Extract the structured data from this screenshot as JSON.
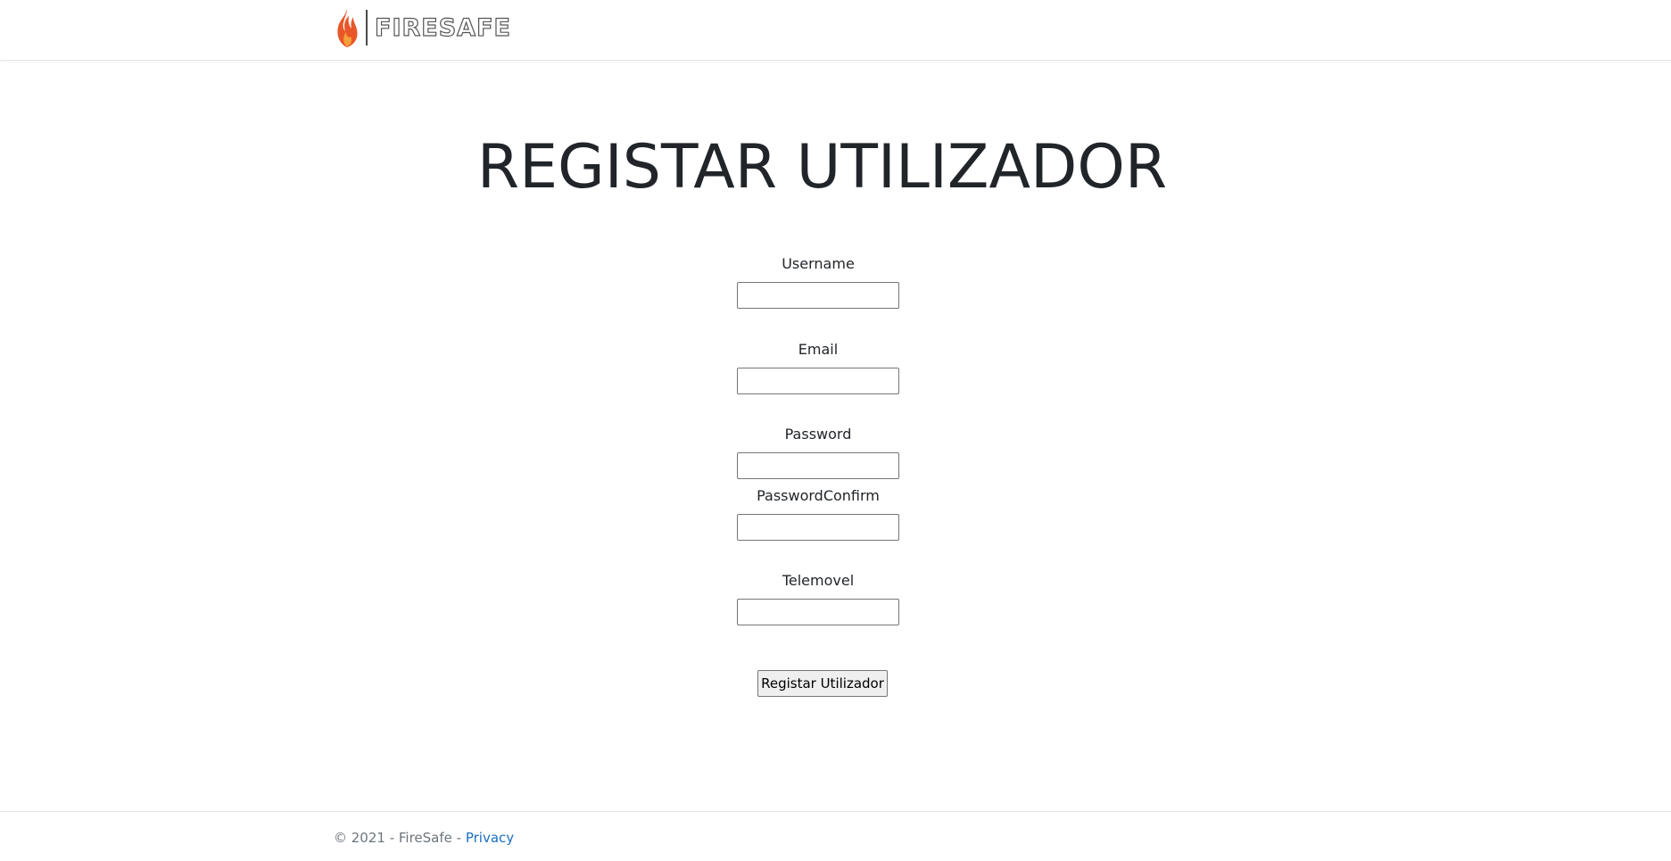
{
  "navbar": {
    "brand_name": "FIRESAFE",
    "accent_color": "#e8572a"
  },
  "page": {
    "title": "REGISTAR UTILIZADOR"
  },
  "form": {
    "username": {
      "label": "Username",
      "value": ""
    },
    "email": {
      "label": "Email",
      "value": ""
    },
    "password": {
      "label": "Password",
      "value": ""
    },
    "password_confirm": {
      "label": "PasswordConfirm",
      "value": ""
    },
    "telemovel": {
      "label": "Telemovel",
      "value": ""
    },
    "submit_label": "Registar Utilizador"
  },
  "footer": {
    "copyright": "© 2021 - FireSafe - ",
    "privacy_link": "Privacy",
    "link_color": "#1b6ec2"
  }
}
